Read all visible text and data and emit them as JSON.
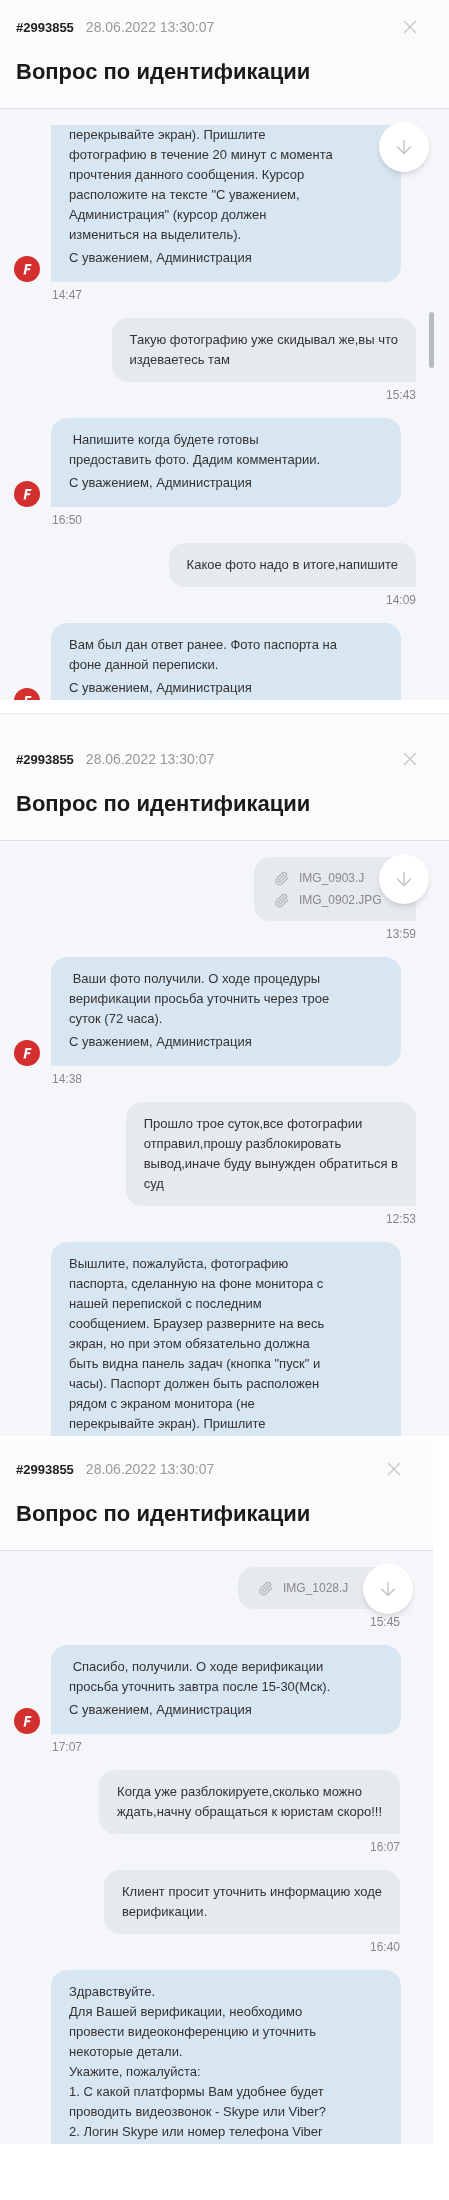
{
  "panels": [
    {
      "ticket_id": "#2993855",
      "date": "28.06.2022 13:30:07",
      "title": "Вопрос по идентификации",
      "scrollbar": true,
      "messages": [
        {
          "kind": "admin",
          "cut_top": true,
          "cut_bottom": false,
          "avatar": true,
          "text": "перекрывайте экран). Пришлите\nфотографию в течение 20 минут с момента\nпрочтения данного сообщения. Курсор\nрасположите на тексте \"С уважением,\nАдминистрация\" (курсор должен\nизмениться на выделитель).",
          "signature": "С уважением, Администрация",
          "time": "14:47"
        },
        {
          "kind": "user",
          "cut_top": false,
          "cut_bottom": false,
          "text": "Такую фотографию уже скидывал же,вы что\nиздеваетесь там",
          "time": "15:43"
        },
        {
          "kind": "admin",
          "cut_top": false,
          "cut_bottom": false,
          "avatar": true,
          "text": " Напишите когда будете готовы\nпредоставить фото. Дадим комментарии.",
          "signature": "С уважением, Администрация",
          "time": "16:50"
        },
        {
          "kind": "user",
          "cut_top": false,
          "cut_bottom": false,
          "text": "Какое фото надо в итоге,напишите",
          "time": "14:09"
        },
        {
          "kind": "admin",
          "cut_top": false,
          "cut_bottom": true,
          "avatar": true,
          "text": "Вам был дан ответ ранее. Фото паспорта на\nфоне данной переписки.",
          "signature": "С уважением, Администрация"
        }
      ]
    },
    {
      "ticket_id": "#2993855",
      "date": "28.06.2022 13:30:07",
      "title": "Вопрос по идентификации",
      "scrollbar": false,
      "messages": [
        {
          "kind": "files",
          "cut_top": false,
          "cut_bottom": false,
          "files": [
            "IMG_0903.J",
            "IMG_0902.JPG"
          ],
          "time": "13:59"
        },
        {
          "kind": "admin",
          "cut_top": false,
          "cut_bottom": false,
          "avatar": true,
          "text": " Ваши фото получили. О ходе процедуры\nверификации просьба уточнить через трое\nсуток (72 часа).",
          "signature": "С уважением, Администрация",
          "time": "14:38"
        },
        {
          "kind": "user",
          "cut_top": false,
          "cut_bottom": false,
          "text": "Прошло трое суток,все фотографии\nотправил,прошу разблокировать\nвывод,иначе буду вынужден обратиться в\nсуд",
          "time": "12:53"
        },
        {
          "kind": "admin",
          "cut_top": false,
          "cut_bottom": true,
          "avatar": false,
          "text": "Вышлите, пожалуйста, фотографию\nпаспорта, сделанную на фоне монитора с\nнашей перепиской с последним\nсообщением. Браузер разверните на весь\nэкран, но при этом обязательно должна\nбыть видна панель задач (кнопка \"пуск\" и\nчасы). Паспорт должен быть расположен\nрядом с экраном монитора (не\nперекрывайте экран). Пришлите"
        }
      ]
    },
    {
      "ticket_id": "#2993855",
      "date": "28.06.2022 13:30:07",
      "title": "Вопрос по идентификации",
      "scrollbar": false,
      "messages": [
        {
          "kind": "files",
          "cut_top": false,
          "cut_bottom": false,
          "files": [
            "IMG_1028.J"
          ],
          "time": "15:45"
        },
        {
          "kind": "admin",
          "cut_top": false,
          "cut_bottom": false,
          "avatar": true,
          "text": " Спасибо, получили. О ходе верификации\nпросьба уточнить завтра после 15-30(Мск).",
          "signature": "С уважением, Администрация",
          "time": "17:07"
        },
        {
          "kind": "user",
          "cut_top": false,
          "cut_bottom": false,
          "text": "Когда уже разблокируете,сколько можно\nждать,начну обращаться к юристам скоро!!!",
          "time": "16:07"
        },
        {
          "kind": "user",
          "cut_top": false,
          "cut_bottom": false,
          "text": "Клиент просит уточнить информацию ходе\nверификации.",
          "time": "16:40"
        },
        {
          "kind": "admin",
          "cut_top": false,
          "cut_bottom": true,
          "avatar": false,
          "text": "Здравствуйте.\nДля Вашей верификации, необходимо\nпровести видеоконференцию и уточнить\nнекоторые детали.\nУкажите, пожалуйста:\n1. С какой платформы Вам удобнее будет\nпроводить видеозвонок - Skype или Viber?\n2. Логин Skype или номер телефона Viber"
        }
      ]
    }
  ]
}
